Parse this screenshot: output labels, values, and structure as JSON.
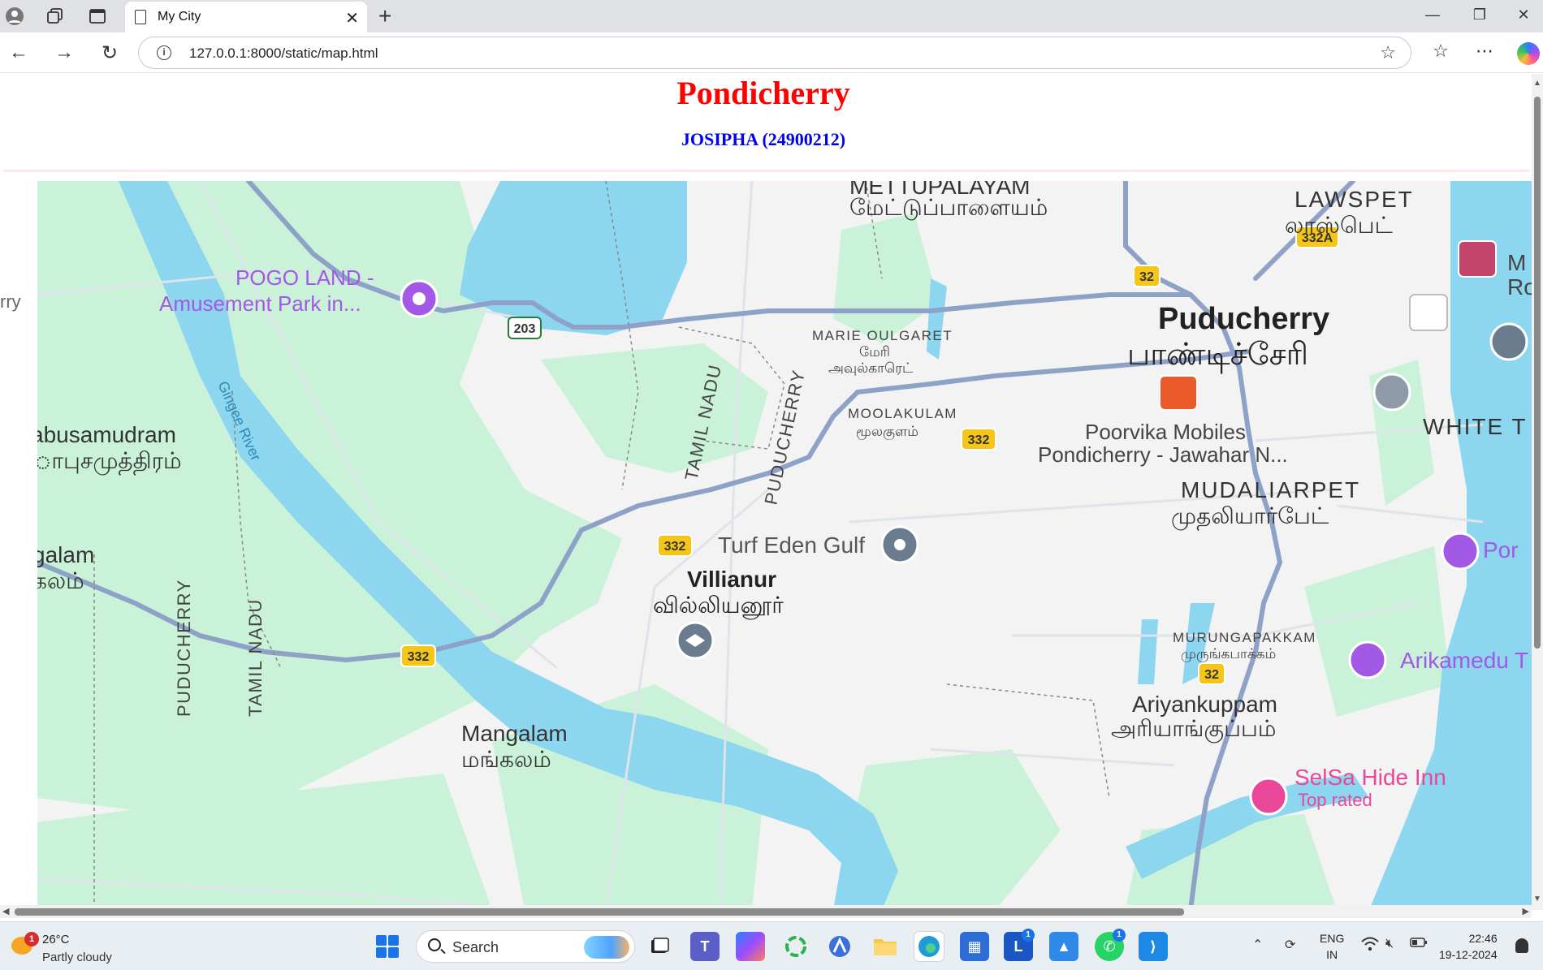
{
  "browser": {
    "tab_title": "My City",
    "url": "127.0.0.1:8000/static/map.html"
  },
  "page": {
    "heading": "Pondicherry",
    "subheading": "JOSIPHA (24900212)",
    "side_fragment": "rry"
  },
  "map": {
    "places": {
      "puducherry_en": "Puducherry",
      "puducherry_ta": "பாண்டிச்சேரி",
      "lawspet_en": "LAWSPET",
      "lawspet_ta": "லாஸ்பெட்",
      "mettupalayam_en": "METTUPALAYAM",
      "mettupalayam_ta": "மேட்டுப்பாளையம்",
      "marie_oulgaret_en": "MARIE OULGARET",
      "marie_oulgaret_ta1": "மேரி",
      "marie_oulgaret_ta2": "அவுல்காரெட்",
      "moolakulam_en": "MOOLAKULAM",
      "moolakulam_ta": "மூலகுளம்",
      "mudaliarpet_en": "MUDALIARPET",
      "mudaliarpet_ta": "முதலியார்பேட்",
      "villianur_en": "Villianur",
      "villianur_ta": "வில்லியனூர்",
      "mangalam_en": "Mangalam",
      "mangalam_ta": "மங்கலம்",
      "murungapakkam_en": "MURUNGAPAKKAM",
      "murungapakkam_ta": "முருங்கபாக்கம்",
      "ariyankuppam_en": "Ariyankuppam",
      "ariyankuppam_ta": "அரியாங்குப்பம்",
      "abusamudram_en": "abusamudram",
      "abusamudram_ta": "ாபுசமுத்திரம்",
      "galam_en": "galam",
      "galam_ta": "கலம்",
      "white_town": "WHITE T",
      "tamil_nadu": "TAMIL NADU",
      "puducherry_border": "PUDUCHERRY",
      "gingee_river": "Gingee River"
    },
    "pois": {
      "pogo_line1": "POGO LAND -",
      "pogo_line2": "Amusement Park in...",
      "poorvika_line1": "Poorvika Mobiles",
      "poorvika_line2": "Pondicherry - Jawahar N...",
      "turf": "Turf Eden Gulf",
      "arikamedu": "Arikamedu T",
      "selsa": "SelSa Hide Inn",
      "selsa_sub": "Top rated",
      "por": "Por",
      "mr1": "M",
      "mr2": "Ro"
    },
    "shields": {
      "nh32": "32",
      "nh332": "332",
      "nh332a": "332A",
      "sh203": "203"
    }
  },
  "taskbar": {
    "temperature": "26°C",
    "weather": "Partly cloudy",
    "weather_badge": "1",
    "search_label": "Search",
    "lang_line1": "ENG",
    "lang_line2": "IN",
    "time": "22:46",
    "date": "19-12-2024",
    "badge_l": "1",
    "badge_w": "1"
  },
  "colors": {
    "heading": "#ff0000",
    "subheading": "#0000ee",
    "water": "#8ad4f0",
    "green": "#c8f0d8",
    "road": "#8fa3c7",
    "shield": "#f5c518"
  }
}
